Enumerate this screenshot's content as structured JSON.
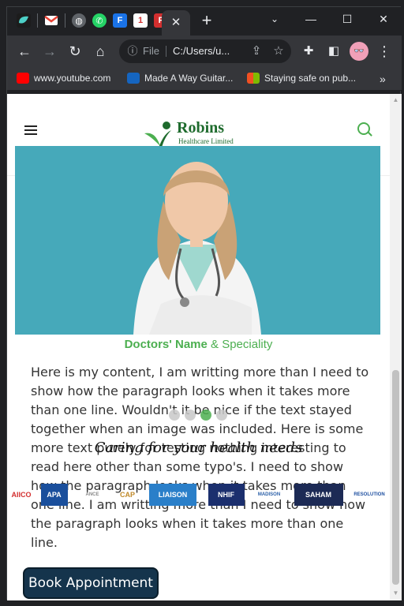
{
  "browser": {
    "tabs": {
      "favicons": [
        "app-logo-icon",
        "gmail-icon",
        "globe-icon",
        "whatsapp-icon",
        "f-icon",
        "flag-icon",
        "tf-icon"
      ],
      "active_close": "✕",
      "new_tab": "+"
    },
    "window_controls": {
      "minimize": "—",
      "maximize": "☐",
      "close": "✕"
    },
    "toolbar": {
      "file_label": "File",
      "url": "C:/Users/u...",
      "avatar": "👓"
    },
    "bookmarks": [
      {
        "label": "www.youtube.com",
        "color": "#ff0000"
      },
      {
        "label": "Made A Way Guitar...",
        "color": "#1565c0"
      },
      {
        "label": "Staying safe on pub...",
        "color": "#f25022"
      }
    ],
    "bookmarks_more": "»"
  },
  "site": {
    "brand": {
      "name": "Robins",
      "subtitle": "Healthcare Limited"
    },
    "doctor": {
      "name": "Doctors' Name",
      "connector": "&",
      "speciality": "Speciality"
    },
    "content": "Here is my content, I am writting more than I need to show how the paragraph looks when it takes more than one line. Wouldn't it be nice if the text stayed together when an image was included. Here is some more text purely for testing nothing interesting to read here other than some typo's. I need to show how the paragraph looks when it takes more than one line. I am writting more than I need to show how the paragraph looks when it takes more than one line.",
    "tagline": "Caring for your health needs",
    "partners": [
      {
        "label": "AIICO"
      },
      {
        "label": "APA"
      },
      {
        "label": "ANCE"
      },
      {
        "label": "CAP"
      },
      {
        "label": "LIAISON"
      },
      {
        "label": "NHIF"
      },
      {
        "label": "MADISON"
      },
      {
        "label": "SAHAM"
      },
      {
        "label": "RESOLUTION"
      }
    ],
    "cta": "Book Appointment",
    "colors": {
      "brand_green": "#4caf50",
      "button_navy": "#15344c"
    }
  }
}
